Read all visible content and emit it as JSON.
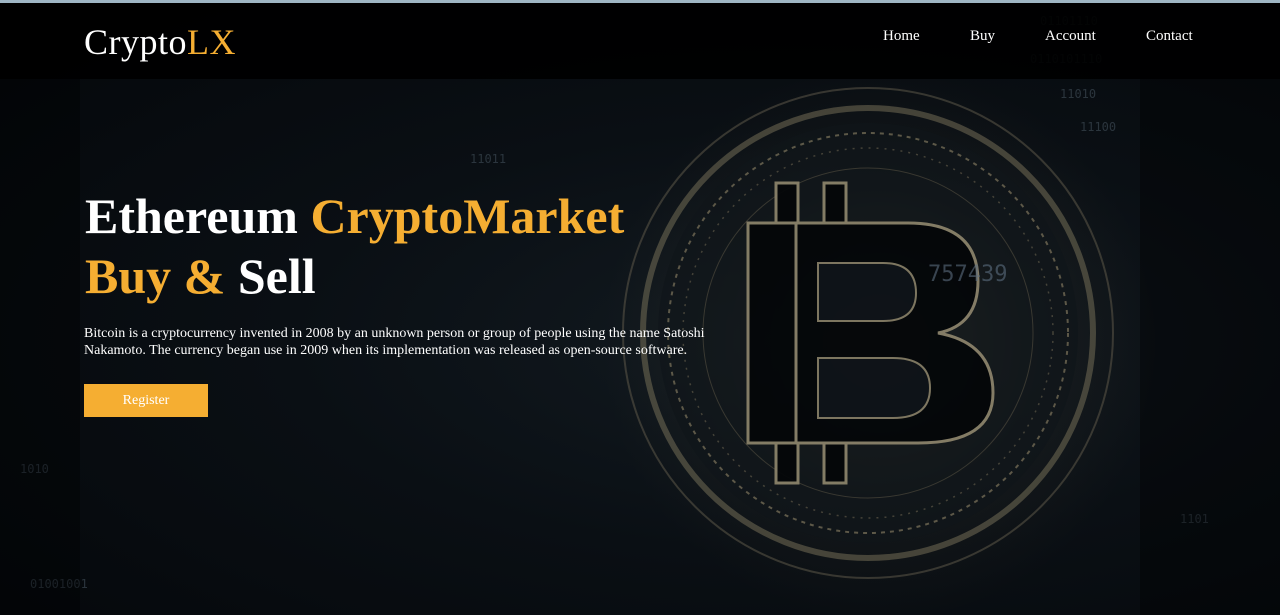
{
  "brand": {
    "name_part1": "Crypto",
    "name_part2": "LX",
    "accent_color": "#f5ae32"
  },
  "nav": {
    "items": [
      {
        "label": "Home"
      },
      {
        "label": "Buy"
      },
      {
        "label": "Account"
      },
      {
        "label": "Contact"
      }
    ]
  },
  "hero": {
    "title_line1_white": "Ethereum ",
    "title_line1_gold": "CryptoMarket",
    "title_line2_gold": "Buy & ",
    "title_line2_white": "Sell",
    "description": "Bitcoin is a cryptocurrency invented in 2008 by an unknown person or group of people using the name Satoshi Nakamoto. The currency began use in 2009 when its implementation was released as open-source software.",
    "register_label": "Register",
    "background_image": "bitcoin-coin-digital-image"
  }
}
